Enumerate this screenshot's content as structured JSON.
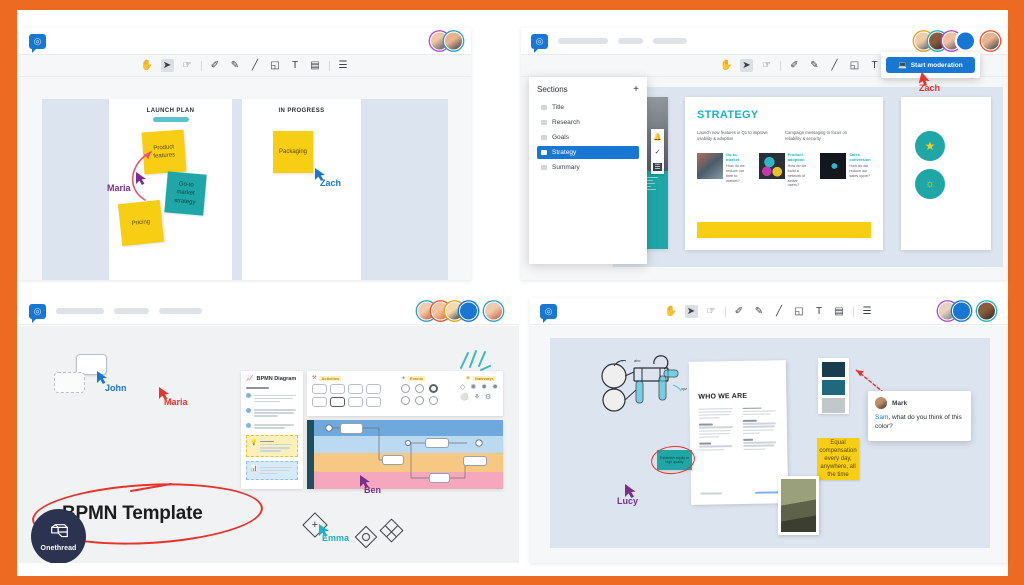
{
  "brand": {
    "logo_name": "Onethread",
    "accent_orange": "#ED6A22",
    "accent_blue": "#1877D2",
    "accent_teal": "#1FA7A7",
    "accent_yellow": "#F7CE13",
    "logo_word": "Onethread"
  },
  "toolbar": {
    "tools": [
      {
        "name": "hand-tool",
        "glyph": "✋"
      },
      {
        "name": "select-cursor-tool",
        "glyph": "➤",
        "selected": true
      },
      {
        "name": "grab-tool",
        "glyph": "☞"
      },
      {
        "name": "pen-tool",
        "glyph": "✐"
      },
      {
        "name": "marker-tool",
        "glyph": "✎"
      },
      {
        "name": "line-tool",
        "glyph": "╱"
      },
      {
        "name": "shape-tool",
        "glyph": "◱"
      },
      {
        "name": "text-tool",
        "glyph": "T"
      },
      {
        "name": "sticky-note-tool",
        "glyph": "▤"
      },
      {
        "name": "comment-tool",
        "glyph": "☰"
      }
    ]
  },
  "panel_board": {
    "columns": [
      {
        "title": "LAUNCH PLAN",
        "notes": [
          {
            "text": "Product features",
            "color": "yellow"
          },
          {
            "text": "Go-to market strategy",
            "color": "teal"
          },
          {
            "text": "Pricing",
            "color": "yellow"
          }
        ]
      },
      {
        "title": "IN PROGRESS",
        "notes": [
          {
            "text": "Packaging",
            "color": "yellow"
          }
        ]
      }
    ],
    "cursors": [
      {
        "label": "Maria",
        "color": "#7B2D8E"
      },
      {
        "label": "Zach",
        "color": "#1877D2"
      }
    ]
  },
  "panel_strategy": {
    "sections": {
      "title": "Sections",
      "add_label": "+",
      "items": [
        {
          "label": "Title",
          "active": false
        },
        {
          "label": "Research",
          "active": false
        },
        {
          "label": "Goals",
          "active": false
        },
        {
          "label": "Strategy",
          "active": true
        },
        {
          "label": "Summary",
          "active": false
        }
      ]
    },
    "slide": {
      "title": "STRATEGY",
      "subtitles": [
        "Launch new features in Q1 to improve usability & adoption",
        "Campaign messaging to focus on reliability & security"
      ],
      "cards": [
        {
          "heading": "Go-to-market",
          "body": "How do we reduce our time to market?"
        },
        {
          "heading": "Product adoption",
          "body": "How do we build a network of active users?"
        },
        {
          "heading": "Sales conversion",
          "body": "How do we reduce our sales cycle?"
        }
      ]
    },
    "moderation": {
      "button_label": "Start moderation",
      "cursor_label": "Zach",
      "cursor_color": "#E8322B"
    }
  },
  "panel_bpmn": {
    "big_title": "BPMN Template",
    "diagram_title": "BPMN Diagram",
    "palette_groups": [
      "Activities",
      "Events",
      "Gateways"
    ],
    "cursors": [
      {
        "label": "John",
        "color": "#1877D2"
      },
      {
        "label": "Maria",
        "color": "#E8322B"
      },
      {
        "label": "Ben",
        "color": "#7B2D8E"
      },
      {
        "label": "Emma",
        "color": "#1BB3C4"
      }
    ],
    "lane_colors": [
      "#6FA8DC",
      "#BBD9F1",
      "#F7C884",
      "#F4A7BD"
    ]
  },
  "panel_doc": {
    "doc_heading": "WHO WE ARE",
    "sticky_text": "Equal compensation every day, anywhere, all the time",
    "highlight_text": "Establish equity in high quality",
    "swatches": [
      "#1A3D4D",
      "#20697D",
      "#C2C7C9"
    ],
    "comment": {
      "author": "Mark",
      "mention": "Sam",
      "text": ", what do you think of this color?"
    },
    "cursors": [
      {
        "label": "Lucy",
        "color": "#7B2D8E"
      }
    ]
  }
}
